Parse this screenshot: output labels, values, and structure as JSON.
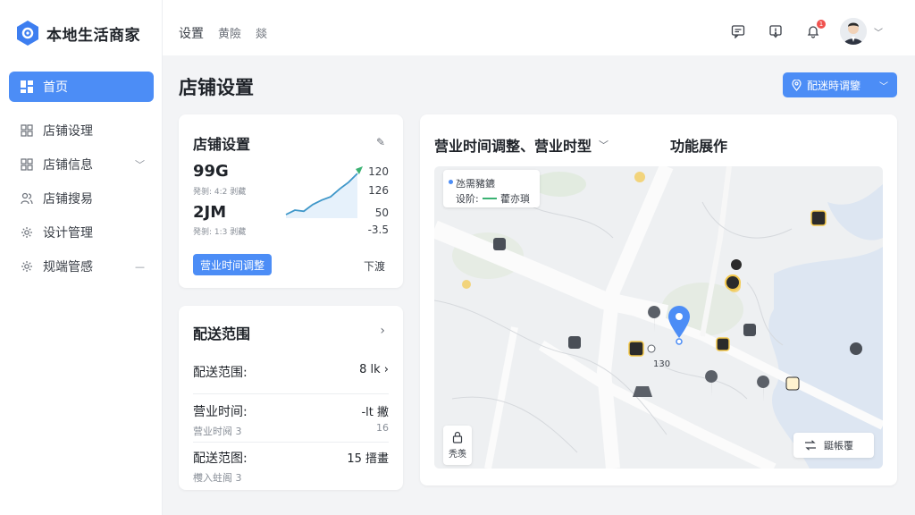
{
  "app": {
    "title": "本地生活商家"
  },
  "sidebar": {
    "items": [
      {
        "label": "首页",
        "icon": "grid-icon",
        "active": true
      },
      {
        "label": "店铺设理",
        "icon": "grid-icon"
      },
      {
        "label": "店铺信息",
        "icon": "grid-icon",
        "caret": "﹀"
      },
      {
        "label": "店铺搜易",
        "icon": "users-icon"
      },
      {
        "label": "设计管理",
        "icon": "gear-icon"
      },
      {
        "label": "规端管感",
        "icon": "gear-icon",
        "caret": "—"
      }
    ]
  },
  "topbar": {
    "tabs": [
      "设置",
      "黄險",
      "燚"
    ],
    "notification_count": "1"
  },
  "page": {
    "title": "店铺设置",
    "action_button": "配迷時谓鑒"
  },
  "store_card": {
    "title": "店铺设置",
    "metric1_value": "99G",
    "metric1_sub": "発剝: 4:2 剥藏",
    "metric2_value": "2JM",
    "metric2_sub": "発剝: 1:3 剥藏",
    "axis_labels": [
      "120",
      "126",
      "50",
      "-3.5"
    ],
    "primary_button": "营业时间调整",
    "secondary_link": "下渡",
    "trend": [
      12,
      20,
      18,
      30,
      38,
      44,
      58,
      70,
      86
    ]
  },
  "delivery_card": {
    "title": "配送范围",
    "rows": [
      {
        "label": "配送范围:",
        "value": "8 lk ›"
      },
      {
        "label": "营业时间:",
        "value": "-lt 撇",
        "sub": "营业时阋 3",
        "subval": "16"
      },
      {
        "label": "配送范图:",
        "value": "15 搢畫",
        "sub": "欆入蛀阁 3"
      }
    ]
  },
  "map_card": {
    "title_left": "营业时间调整、营业时型",
    "title_right": "功能展作",
    "legend_line1": "氹需豬鑣",
    "legend_line2": "设阶:",
    "legend_line2b": "藿亦瑣",
    "left_control_label": "秃羡",
    "right_control_label": "鼮帳覆",
    "map_labels": [
      "130"
    ],
    "colors": {
      "pin": "#4c8df6",
      "water": "#dde6f2",
      "road": "#ffffff"
    }
  }
}
